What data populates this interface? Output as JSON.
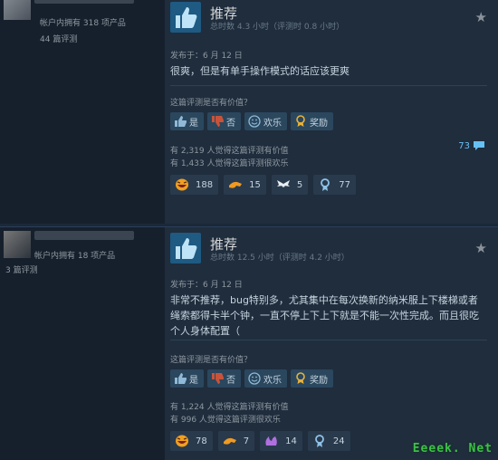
{
  "reviews": [
    {
      "owned": "帐户内拥有 318 项产品",
      "review_count": "44 篇评测",
      "verdict": "推荐",
      "hours": "总时数 4.3 小时（评测时 0.8 小时）",
      "posted": "发布于：6 月 12 日",
      "body": "很爽，但是有单手操作模式的话应该更爽",
      "helpful_question": "这篇评测是否有价值？",
      "buttons": {
        "yes": "是",
        "no": "否",
        "funny": "欢乐",
        "award": "奖励"
      },
      "helpful_stat": "有 2,319 人觉得这篇评测有价值",
      "funny_stat": "有 1,433 人觉得这篇评测很欢乐",
      "comments": "73",
      "awards": [
        "188",
        "15",
        "5",
        "77"
      ]
    },
    {
      "owned": "帐户内拥有 18 项产品",
      "review_count": "3 篇评测",
      "verdict": "推荐",
      "hours": "总时数 12.5 小时（评测时 4.2 小时）",
      "posted": "发布于：6 月 12 日",
      "body": "非常不推荐，bug特别多，尤其集中在每次换新的纳米服上下楼梯或者绳索都得卡半个钟，一直不停上下上下就是不能一次性完成。而且很吃个人身体配置（",
      "helpful_question": "这篇评测是否有价值？",
      "buttons": {
        "yes": "是",
        "no": "否",
        "funny": "欢乐",
        "award": "奖励"
      },
      "helpful_stat": "有 1,224 人觉得这篇评测有价值",
      "funny_stat": "有 996 人觉得这篇评测很欢乐",
      "awards": [
        "78",
        "7",
        "14",
        "24"
      ]
    }
  ],
  "watermark": "Eeeek. Net",
  "colors": {
    "accent": "#66c0f4",
    "thumb_bg": "#1e5a82",
    "watermark": "#3fbf4a"
  }
}
